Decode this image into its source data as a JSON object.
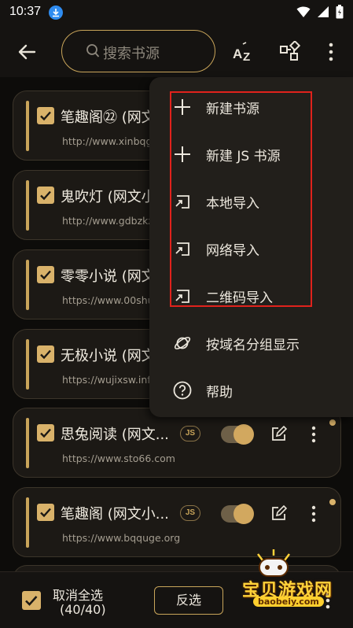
{
  "status_bar": {
    "time": "10:37"
  },
  "toolbar": {
    "search_placeholder": "搜索书源"
  },
  "sources": [
    {
      "name": "笔趣阁㉒ (网文小说)",
      "url": "http://www.xinbqg.com",
      "checked": true
    },
    {
      "name": "鬼吹灯 (网文小说)",
      "url": "http://www.gdbzkz.com",
      "checked": true
    },
    {
      "name": "零零小说 (网文小说)",
      "url": "https://www.00shu.la",
      "checked": true
    },
    {
      "name": "无极小说 (网文小说)",
      "url": "https://wujixsw.info",
      "checked": true
    },
    {
      "name": "思兔阅读 (网文...",
      "url": "https://www.sto66.com",
      "checked": true,
      "js_badge": "JS",
      "enabled": true
    },
    {
      "name": "笔趣阁 (网文小...",
      "url": "https://www.bqquge.org",
      "checked": true,
      "js_badge": "JS",
      "enabled": true
    }
  ],
  "menu": {
    "items": [
      {
        "label": "新建书源",
        "icon": "plus-icon"
      },
      {
        "label": "新建 JS 书源",
        "icon": "plus-icon"
      },
      {
        "label": "本地导入",
        "icon": "import-icon"
      },
      {
        "label": "网络导入",
        "icon": "import-icon"
      },
      {
        "label": "二维码导入",
        "icon": "import-icon"
      },
      {
        "label": "按域名分组显示",
        "icon": "planet-icon"
      },
      {
        "label": "帮助",
        "icon": "help-icon"
      }
    ]
  },
  "bottom_bar": {
    "select_all_label": "取消全选",
    "count": "(40/40)",
    "invert_label": "反选"
  },
  "watermark": {
    "title": "宝贝游戏网",
    "domain": "baobeiy.com"
  },
  "colors": {
    "accent": "#c9a55a",
    "background": "#0d0c0a",
    "highlight_box": "#e0221c"
  }
}
